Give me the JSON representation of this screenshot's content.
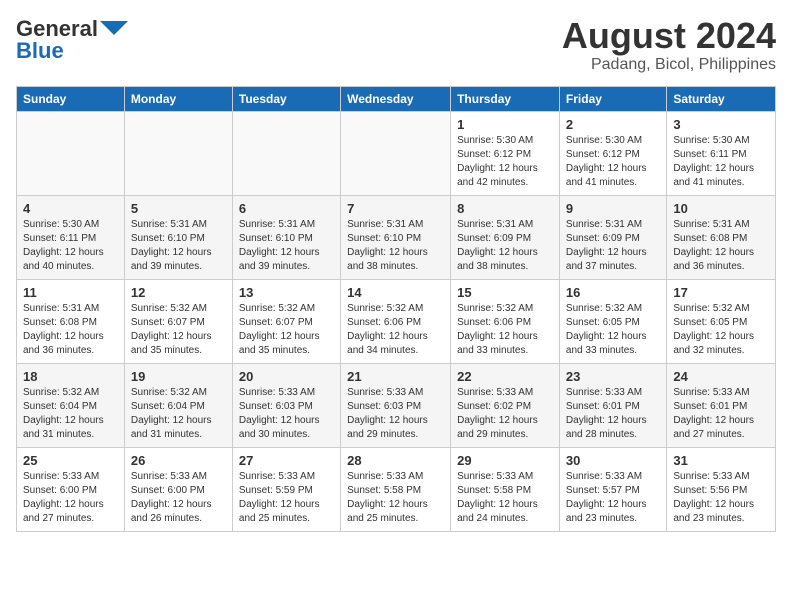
{
  "logo": {
    "general": "General",
    "blue": "Blue"
  },
  "title": "August 2024",
  "subtitle": "Padang, Bicol, Philippines",
  "weekdays": [
    "Sunday",
    "Monday",
    "Tuesday",
    "Wednesday",
    "Thursday",
    "Friday",
    "Saturday"
  ],
  "weeks": [
    [
      {
        "day": "",
        "info": ""
      },
      {
        "day": "",
        "info": ""
      },
      {
        "day": "",
        "info": ""
      },
      {
        "day": "",
        "info": ""
      },
      {
        "day": "1",
        "info": "Sunrise: 5:30 AM\nSunset: 6:12 PM\nDaylight: 12 hours\nand 42 minutes."
      },
      {
        "day": "2",
        "info": "Sunrise: 5:30 AM\nSunset: 6:12 PM\nDaylight: 12 hours\nand 41 minutes."
      },
      {
        "day": "3",
        "info": "Sunrise: 5:30 AM\nSunset: 6:11 PM\nDaylight: 12 hours\nand 41 minutes."
      }
    ],
    [
      {
        "day": "4",
        "info": "Sunrise: 5:30 AM\nSunset: 6:11 PM\nDaylight: 12 hours\nand 40 minutes."
      },
      {
        "day": "5",
        "info": "Sunrise: 5:31 AM\nSunset: 6:10 PM\nDaylight: 12 hours\nand 39 minutes."
      },
      {
        "day": "6",
        "info": "Sunrise: 5:31 AM\nSunset: 6:10 PM\nDaylight: 12 hours\nand 39 minutes."
      },
      {
        "day": "7",
        "info": "Sunrise: 5:31 AM\nSunset: 6:10 PM\nDaylight: 12 hours\nand 38 minutes."
      },
      {
        "day": "8",
        "info": "Sunrise: 5:31 AM\nSunset: 6:09 PM\nDaylight: 12 hours\nand 38 minutes."
      },
      {
        "day": "9",
        "info": "Sunrise: 5:31 AM\nSunset: 6:09 PM\nDaylight: 12 hours\nand 37 minutes."
      },
      {
        "day": "10",
        "info": "Sunrise: 5:31 AM\nSunset: 6:08 PM\nDaylight: 12 hours\nand 36 minutes."
      }
    ],
    [
      {
        "day": "11",
        "info": "Sunrise: 5:31 AM\nSunset: 6:08 PM\nDaylight: 12 hours\nand 36 minutes."
      },
      {
        "day": "12",
        "info": "Sunrise: 5:32 AM\nSunset: 6:07 PM\nDaylight: 12 hours\nand 35 minutes."
      },
      {
        "day": "13",
        "info": "Sunrise: 5:32 AM\nSunset: 6:07 PM\nDaylight: 12 hours\nand 35 minutes."
      },
      {
        "day": "14",
        "info": "Sunrise: 5:32 AM\nSunset: 6:06 PM\nDaylight: 12 hours\nand 34 minutes."
      },
      {
        "day": "15",
        "info": "Sunrise: 5:32 AM\nSunset: 6:06 PM\nDaylight: 12 hours\nand 33 minutes."
      },
      {
        "day": "16",
        "info": "Sunrise: 5:32 AM\nSunset: 6:05 PM\nDaylight: 12 hours\nand 33 minutes."
      },
      {
        "day": "17",
        "info": "Sunrise: 5:32 AM\nSunset: 6:05 PM\nDaylight: 12 hours\nand 32 minutes."
      }
    ],
    [
      {
        "day": "18",
        "info": "Sunrise: 5:32 AM\nSunset: 6:04 PM\nDaylight: 12 hours\nand 31 minutes."
      },
      {
        "day": "19",
        "info": "Sunrise: 5:32 AM\nSunset: 6:04 PM\nDaylight: 12 hours\nand 31 minutes."
      },
      {
        "day": "20",
        "info": "Sunrise: 5:33 AM\nSunset: 6:03 PM\nDaylight: 12 hours\nand 30 minutes."
      },
      {
        "day": "21",
        "info": "Sunrise: 5:33 AM\nSunset: 6:03 PM\nDaylight: 12 hours\nand 29 minutes."
      },
      {
        "day": "22",
        "info": "Sunrise: 5:33 AM\nSunset: 6:02 PM\nDaylight: 12 hours\nand 29 minutes."
      },
      {
        "day": "23",
        "info": "Sunrise: 5:33 AM\nSunset: 6:01 PM\nDaylight: 12 hours\nand 28 minutes."
      },
      {
        "day": "24",
        "info": "Sunrise: 5:33 AM\nSunset: 6:01 PM\nDaylight: 12 hours\nand 27 minutes."
      }
    ],
    [
      {
        "day": "25",
        "info": "Sunrise: 5:33 AM\nSunset: 6:00 PM\nDaylight: 12 hours\nand 27 minutes."
      },
      {
        "day": "26",
        "info": "Sunrise: 5:33 AM\nSunset: 6:00 PM\nDaylight: 12 hours\nand 26 minutes."
      },
      {
        "day": "27",
        "info": "Sunrise: 5:33 AM\nSunset: 5:59 PM\nDaylight: 12 hours\nand 25 minutes."
      },
      {
        "day": "28",
        "info": "Sunrise: 5:33 AM\nSunset: 5:58 PM\nDaylight: 12 hours\nand 25 minutes."
      },
      {
        "day": "29",
        "info": "Sunrise: 5:33 AM\nSunset: 5:58 PM\nDaylight: 12 hours\nand 24 minutes."
      },
      {
        "day": "30",
        "info": "Sunrise: 5:33 AM\nSunset: 5:57 PM\nDaylight: 12 hours\nand 23 minutes."
      },
      {
        "day": "31",
        "info": "Sunrise: 5:33 AM\nSunset: 5:56 PM\nDaylight: 12 hours\nand 23 minutes."
      }
    ]
  ]
}
